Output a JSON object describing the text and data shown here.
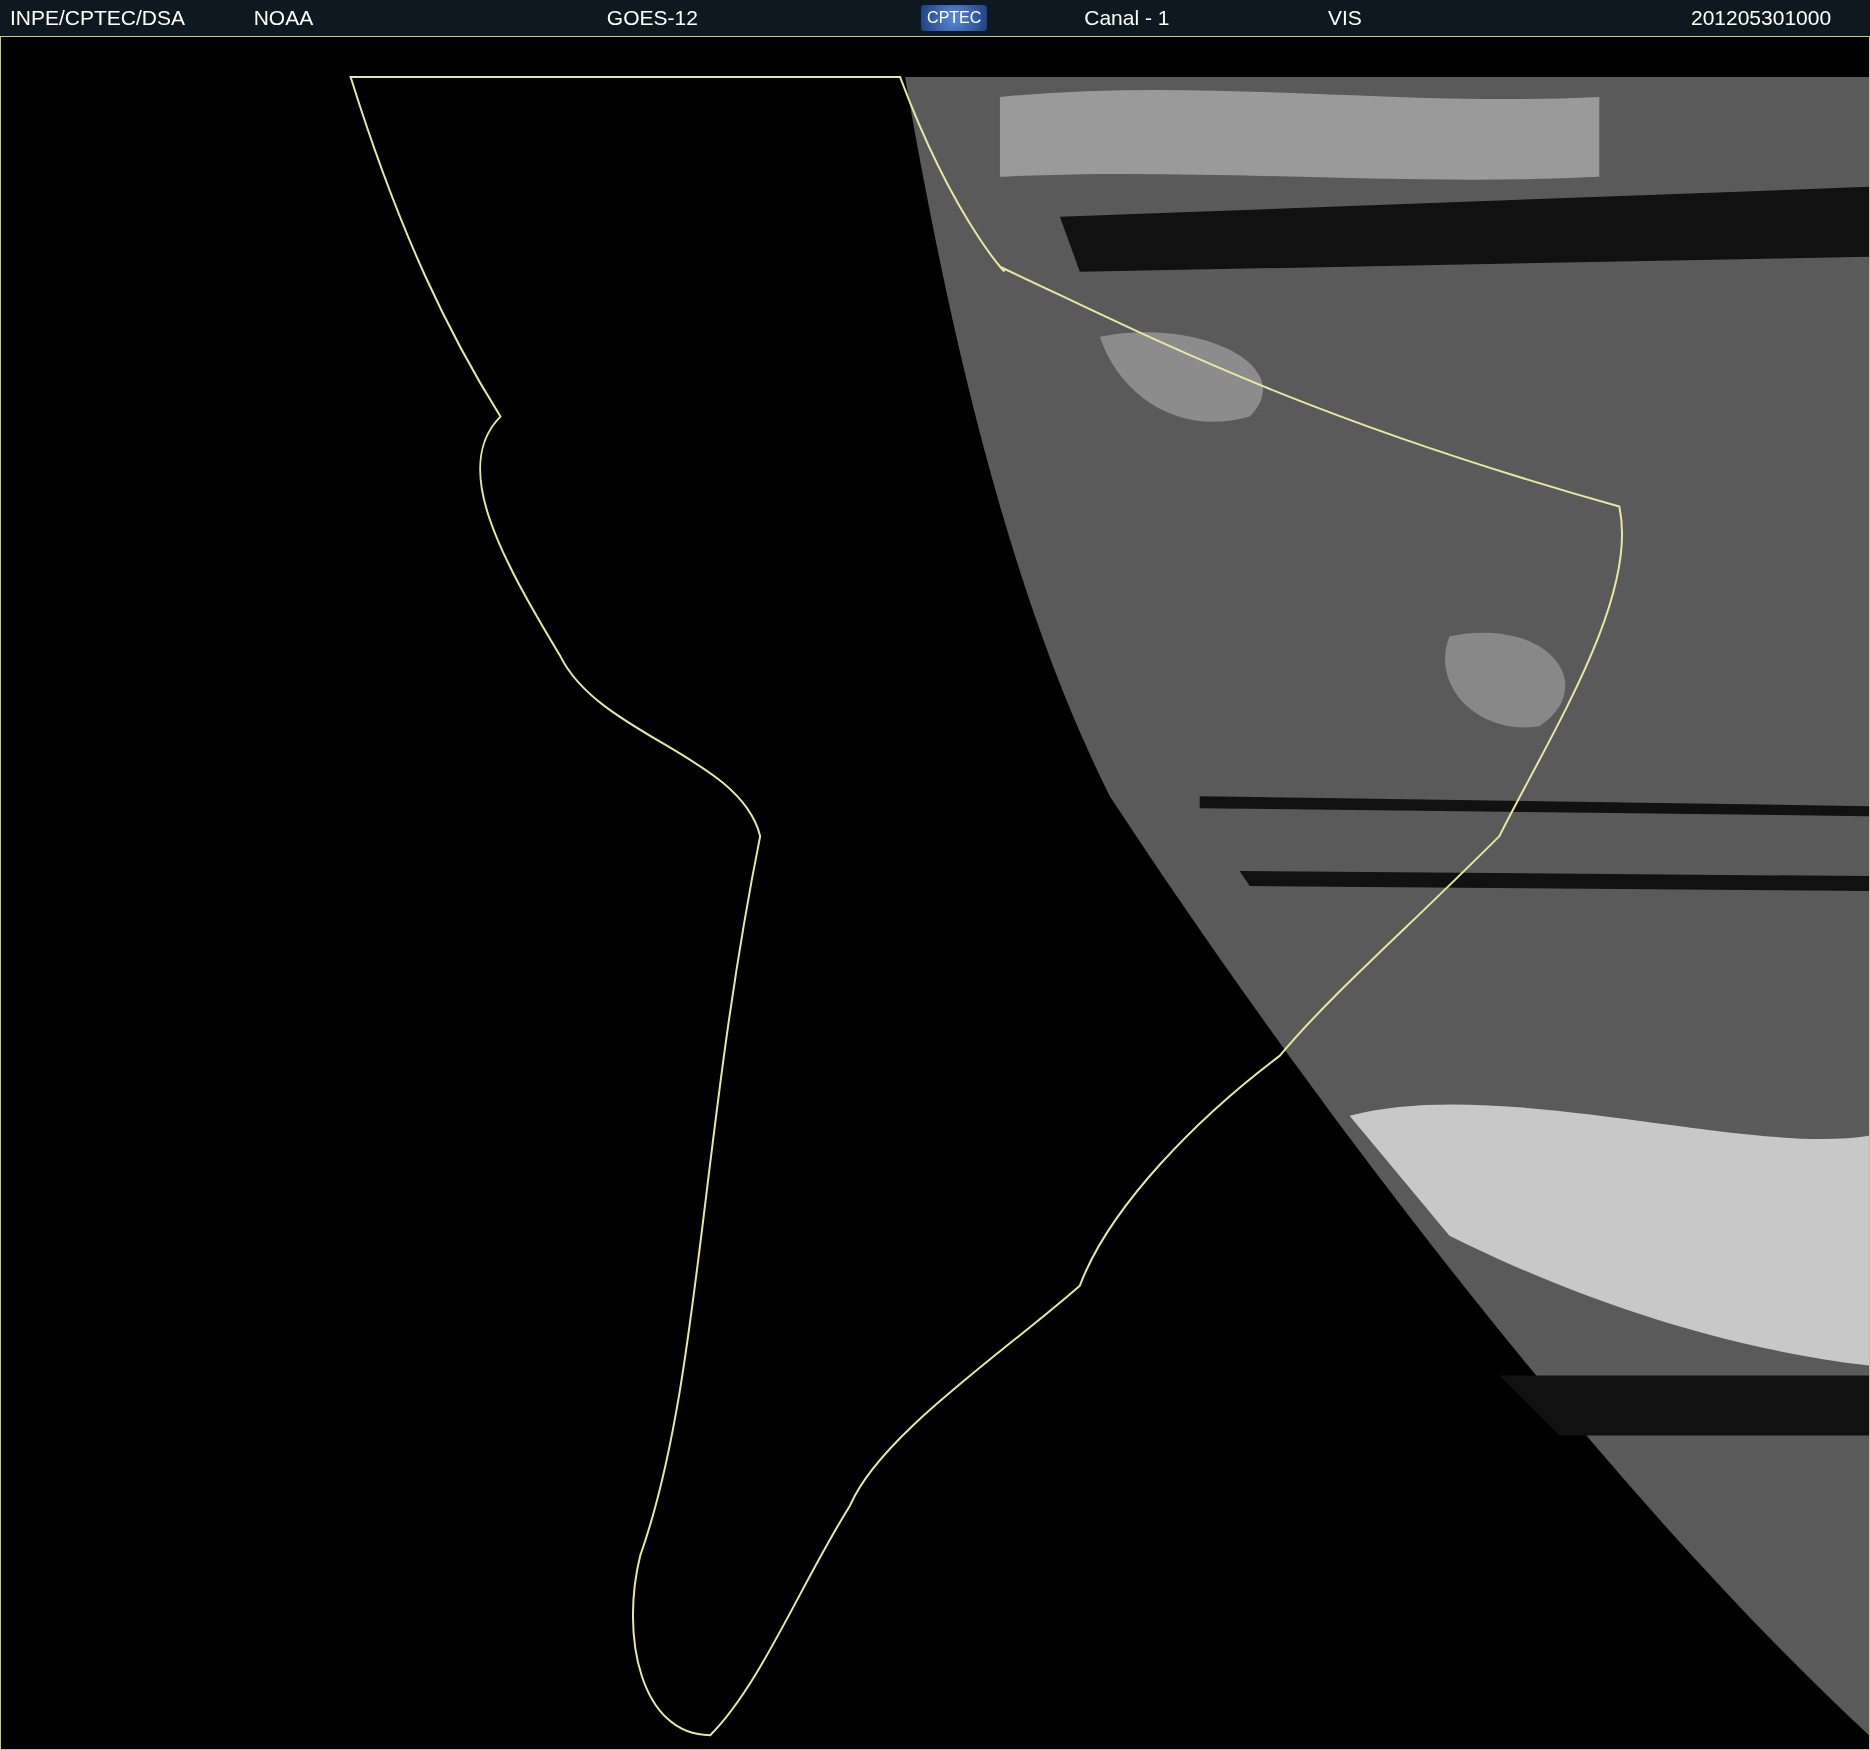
{
  "header": {
    "items": [
      {
        "kind": "text",
        "text": "INPE/CPTEC/DSA"
      },
      {
        "kind": "text",
        "text": "NOAA"
      },
      {
        "kind": "text",
        "text": "GOES-12"
      },
      {
        "kind": "logo",
        "text": "CPTEC"
      },
      {
        "kind": "text",
        "text": "Canal - 1"
      },
      {
        "kind": "text",
        "text": "VIS"
      },
      {
        "kind": "text",
        "text": "201205301000"
      }
    ]
  }
}
